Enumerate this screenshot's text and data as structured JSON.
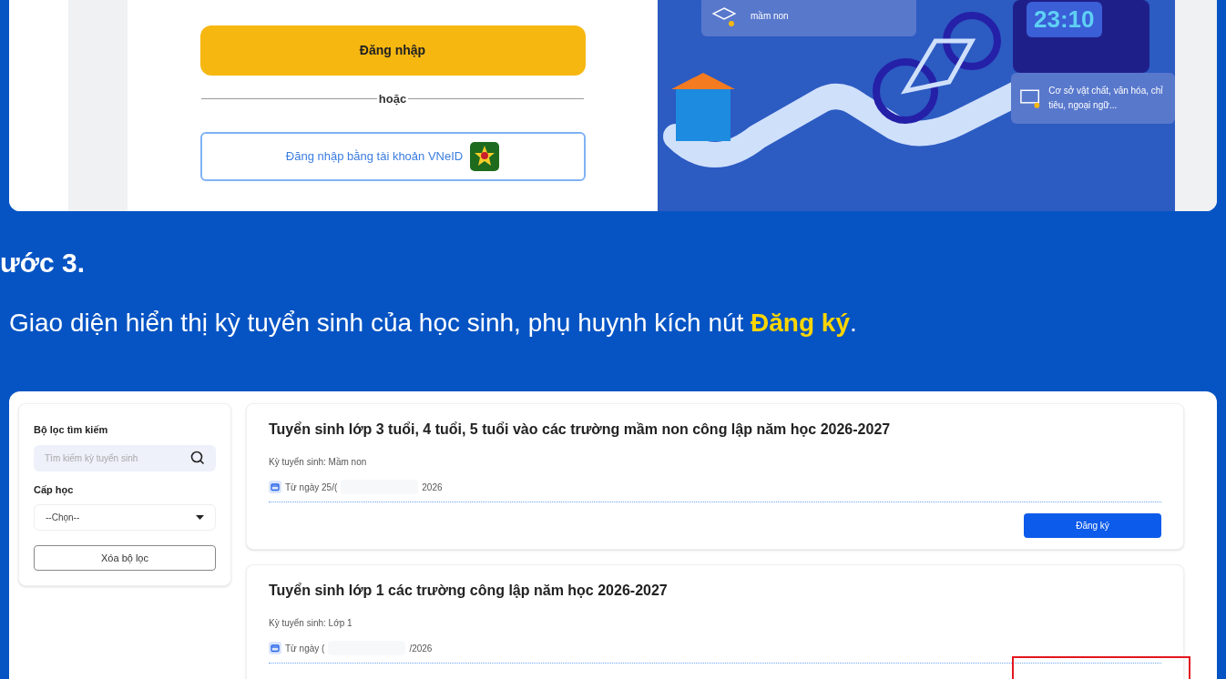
{
  "login_screenshot": {
    "login_button": "Đăng nhập",
    "divider": "hoặc",
    "vneid_button": "Đăng nhập bằng tài khoản VNeID",
    "info_cards": [
      {
        "text": "mầm non"
      },
      {
        "text": "Cơ sở vật chất, văn hóa, chỉ tiêu, ngoại ngữ..."
      }
    ],
    "clock": "23:10"
  },
  "step": {
    "heading": "ước 3.",
    "text": "Giao diện hiển thị kỳ tuyển sinh của học sinh, phụ huynh kích nút **Đăng ký**."
  },
  "enrollment_screenshot": {
    "filter": {
      "title": "Bộ lọc tìm kiếm",
      "search_placeholder": "Tìm kiếm kỳ tuyển sinh",
      "level_label": "Cấp học",
      "level_value": "--Chọn--",
      "clear_button": "Xóa bộ lọc"
    },
    "periods": [
      {
        "title": "Tuyển sinh lớp 3 tuổi, 4 tuổi, 5 tuổi vào các trường mầm non công lập năm học 2026-2027",
        "kind_text": "Kỳ tuyển sinh: Mầm non",
        "date_start": "Từ ngày 25/(",
        "date_end": "2026",
        "register_button": "Đăng ký",
        "highlighted": false
      },
      {
        "title": "Tuyển sinh lớp 1 các trường công lập năm học 2026-2027",
        "kind_text": "Kỳ tuyển sinh: Lớp 1",
        "date_start": "Từ ngày (",
        "date_end": "/2026",
        "highlighted": true
      }
    ]
  }
}
